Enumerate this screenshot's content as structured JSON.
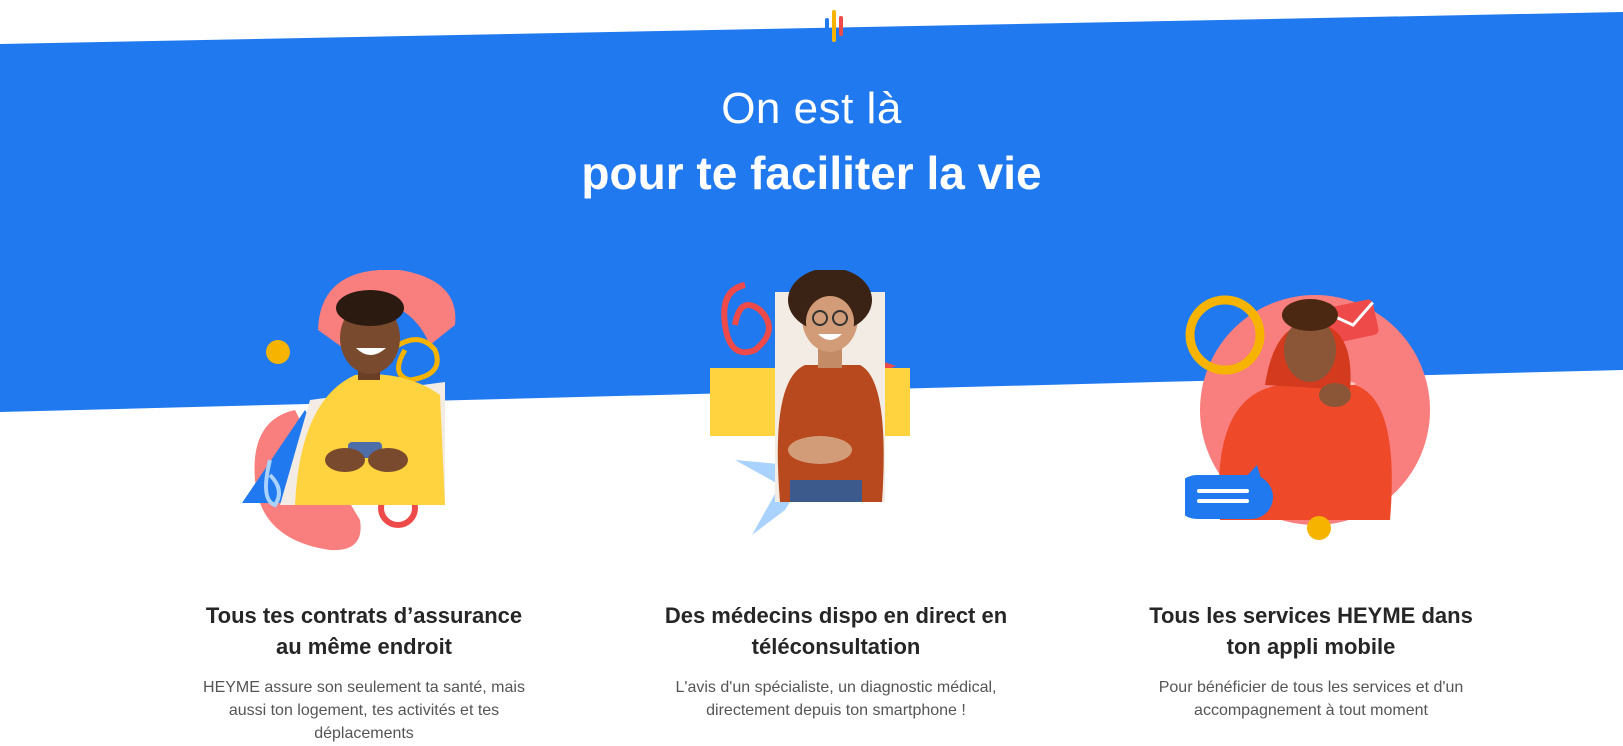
{
  "hero": {
    "headline_light": "On est là",
    "headline_bold": "pour te faciliter la vie",
    "background_color": "#2079ee",
    "logo_colors": [
      "#2079ee",
      "#f6b400",
      "#ee4a4a"
    ]
  },
  "features": [
    {
      "title_line1": "Tous tes contrats d’assurance",
      "title_line2": "au même endroit",
      "text_line1": "HEYME assure son seulement ta santé, mais",
      "text_line2": "aussi ton logement, tes activités et tes",
      "text_line3": "déplacements",
      "illustration": "man-yellow-shirt-phone-photo"
    },
    {
      "title_line1": "Des médecins dispo en direct en",
      "title_line2": "téléconsultation",
      "text_line1": "L'avis d'un spécialiste, un diagnostic médical,",
      "text_line2": "directement depuis ton smartphone !",
      "illustration": "woman-laughing-glasses-photo"
    },
    {
      "title_line1": "Tous les services HEYME dans",
      "title_line2": "ton appli mobile",
      "text_line1": "Pour bénéficier de tous les services et d'un",
      "text_line2": "accompagnement à tout moment",
      "illustration": "man-red-hoodie-photo"
    }
  ]
}
